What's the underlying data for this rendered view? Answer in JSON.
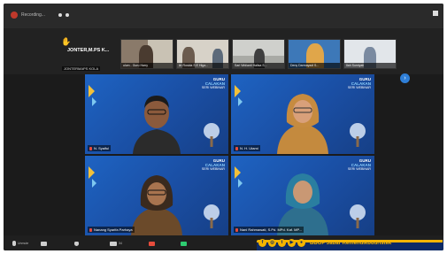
{
  "recording": {
    "label": "Recording..."
  },
  "self_view": {
    "name": "JONTER,M.PS K...",
    "tag": "JONTERMAPS KOLA"
  },
  "strip": {
    "thumbs": [
      {
        "name": "ulum - Guru Harry"
      },
      {
        "name": "iin Rosida S.E Higa..."
      },
      {
        "name": "Sari Widianti Halisa S..."
      },
      {
        "name": "Deny Darmayadi S..."
      },
      {
        "name": "Ilah Sumiyati"
      }
    ]
  },
  "banner": {
    "line1": "GURU",
    "line2": "CALAKAN",
    "line3": "SERI WEBINAR"
  },
  "participants": [
    {
      "name": "N. Syaiful"
    },
    {
      "name": "N. H. Utami"
    },
    {
      "name": "Nanang Syarifa Parhaya"
    },
    {
      "name": "Nani Rahmawati, S.Pd. MPd. Kaf. MP..."
    }
  ],
  "toolbar": {
    "items": [
      {
        "icon": "microphone-icon",
        "label": "Unmute"
      },
      {
        "icon": "video-icon",
        "label": ""
      },
      {
        "icon": "security-icon",
        "label": ""
      },
      {
        "icon": "participants-icon",
        "label": "34"
      },
      {
        "icon": "chat-icon",
        "label": ""
      },
      {
        "icon": "share-icon",
        "label": ""
      }
    ]
  },
  "branding": {
    "text": "BBGP Jabar Kemendikbudristek"
  },
  "colors": {
    "tile_blue": "#1a4fa8",
    "accent_yellow": "#f4b400",
    "speaker_outline": "#d4e157",
    "brand_navy": "#0d2a66"
  }
}
